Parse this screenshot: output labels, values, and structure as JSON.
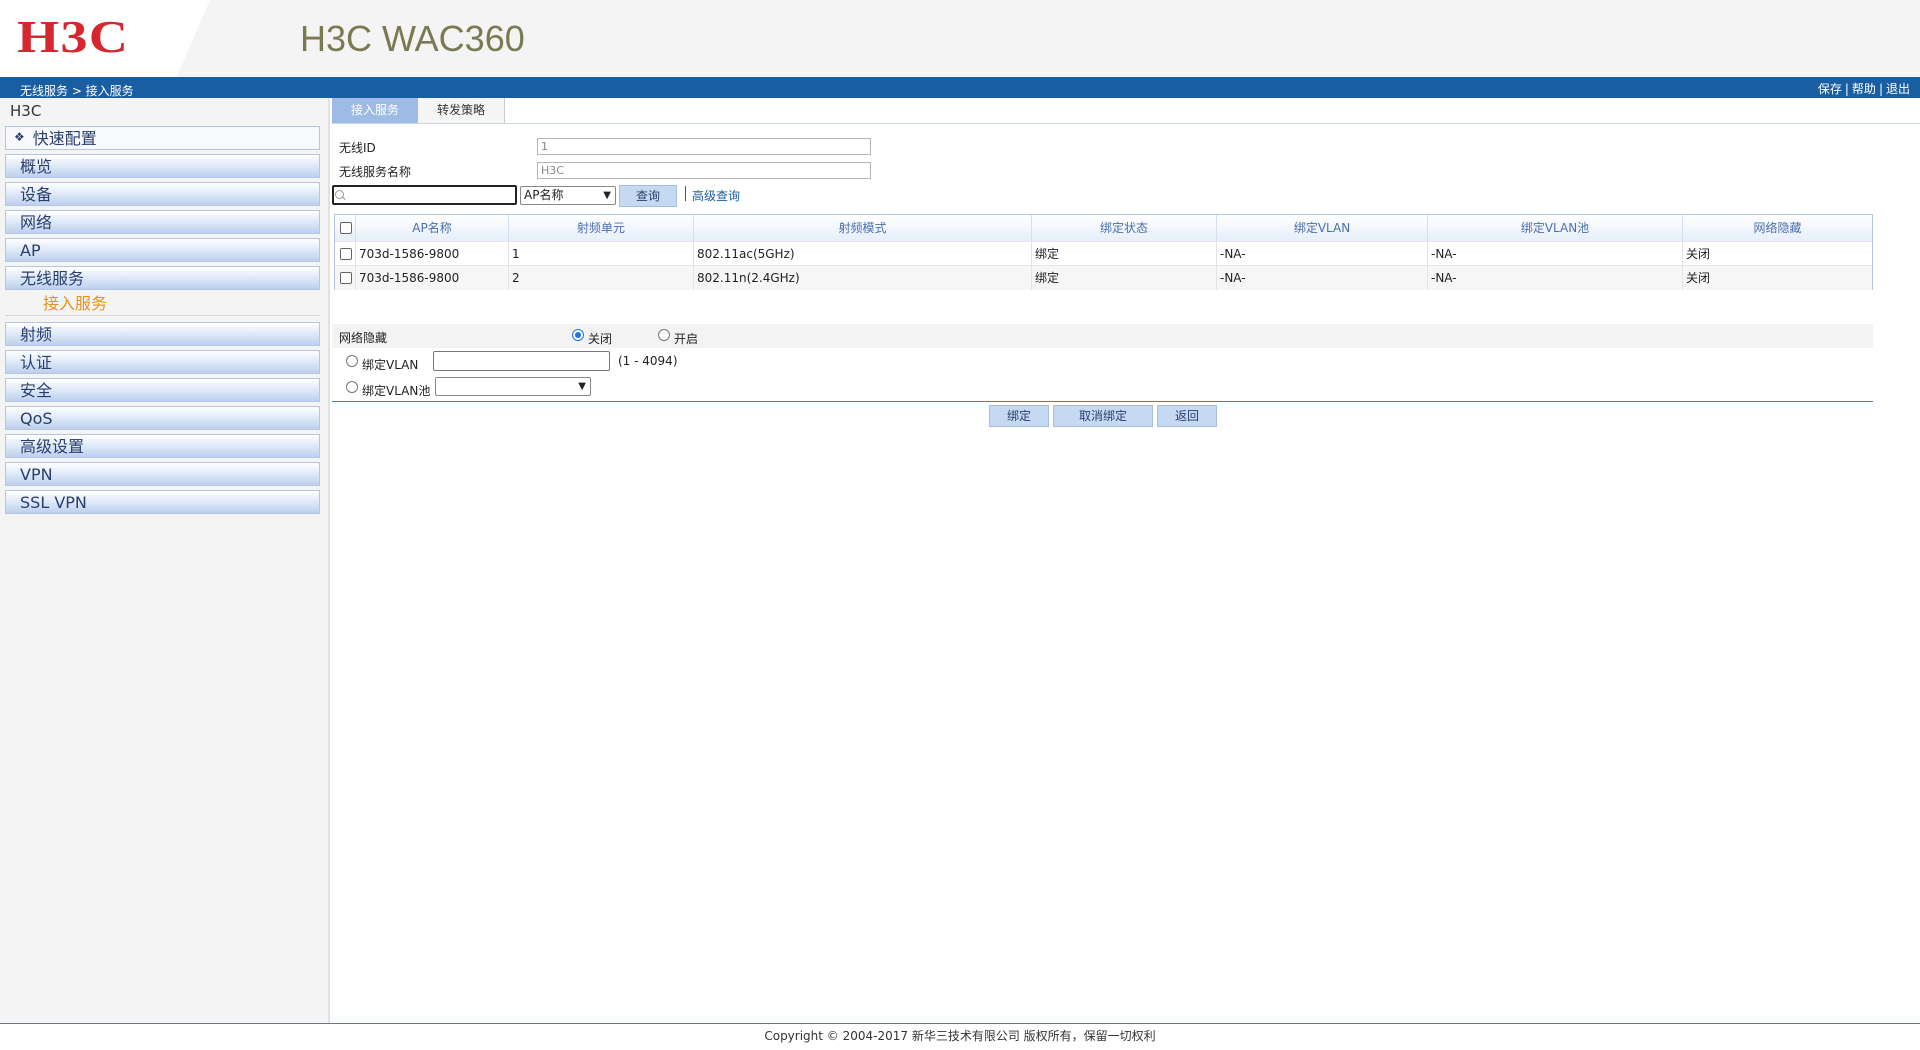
{
  "header": {
    "logo_text": "H3C",
    "product_title": "H3C WAC360"
  },
  "navbar": {
    "breadcrumb": "无线服务 > 接入服务",
    "links": [
      "保存",
      "帮助",
      "退出"
    ]
  },
  "sidebar": {
    "root": "H3C",
    "items": [
      {
        "label": "快速配置"
      },
      {
        "label": "概览"
      },
      {
        "label": "设备"
      },
      {
        "label": "网络"
      },
      {
        "label": "AP"
      },
      {
        "label": "无线服务"
      },
      {
        "label": "接入服务"
      },
      {
        "label": "射频"
      },
      {
        "label": "认证"
      },
      {
        "label": "安全"
      },
      {
        "label": "QoS"
      },
      {
        "label": "高级设置"
      },
      {
        "label": "VPN"
      },
      {
        "label": "SSL VPN"
      }
    ]
  },
  "tabs": [
    {
      "label": "接入服务",
      "active": true
    },
    {
      "label": "转发策略",
      "active": false
    }
  ],
  "form": {
    "wireless_id_label": "无线ID",
    "wireless_id_value": "1",
    "service_name_label": "无线服务名称",
    "service_name_value": "H3C"
  },
  "search": {
    "placeholder": "",
    "field_select": "AP名称",
    "query_button": "查询",
    "advanced_link": "高级查询"
  },
  "table": {
    "headers": [
      "AP名称",
      "射频单元",
      "射频模式",
      "绑定状态",
      "绑定VLAN",
      "绑定VLAN池",
      "网络隐藏"
    ],
    "rows": [
      [
        "703d-1586-9800",
        "1",
        "802.11ac(5GHz)",
        "绑定",
        "-NA-",
        "-NA-",
        "关闭"
      ],
      [
        "703d-1586-9800",
        "2",
        "802.11n(2.4GHz)",
        "绑定",
        "-NA-",
        "-NA-",
        "关闭"
      ]
    ]
  },
  "bind_options": {
    "hide_label": "网络隐藏",
    "hide_off": "关闭",
    "hide_on": "开启",
    "hide_selected": "关闭",
    "vlan_label": "绑定VLAN",
    "vlan_range": "(1 - 4094)",
    "vlan_pool_label": "绑定VLAN池"
  },
  "buttons": {
    "bind": "绑定",
    "unbind": "取消绑定",
    "back": "返回"
  },
  "footer": {
    "copyright": "Copyright © 2004-2017 新华三技术有限公司 版权所有，保留一切权利"
  },
  "colors": {
    "brand_red": "#d6262e",
    "navbar_blue": "#1a5ea2",
    "submenu_orange": "#e39321",
    "header_olive": "#7a7a52"
  }
}
